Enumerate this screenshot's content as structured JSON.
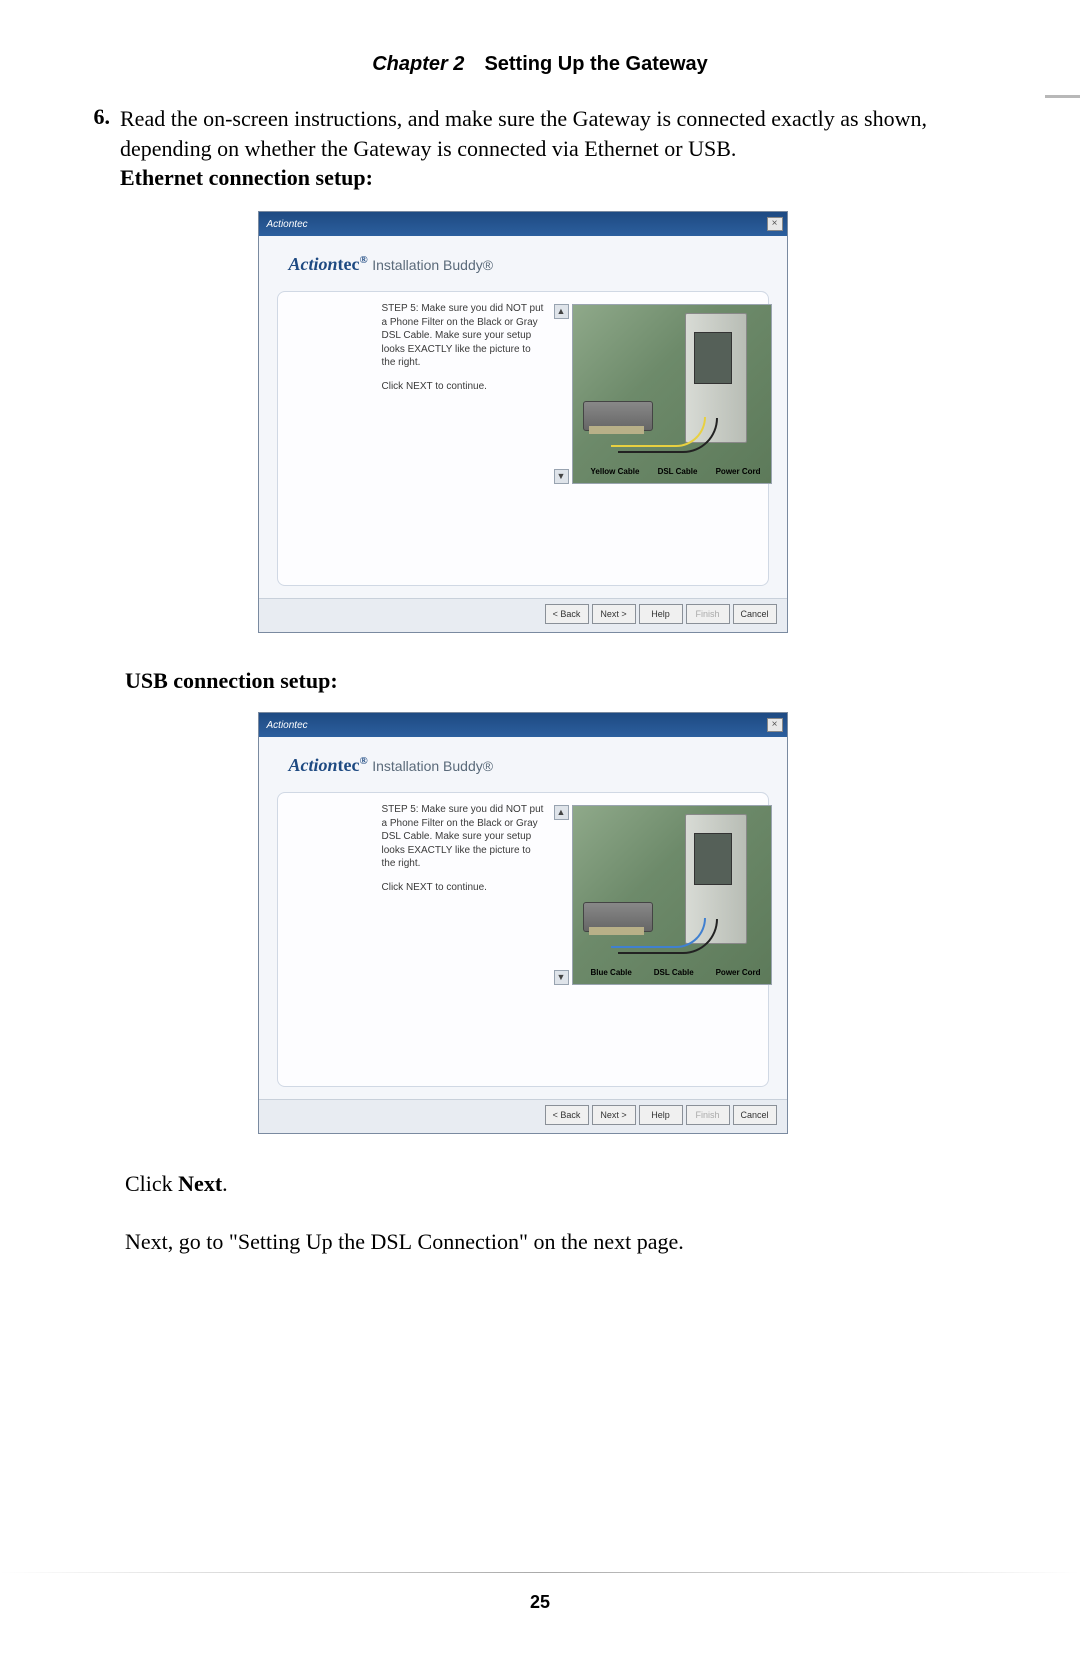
{
  "header": {
    "chapter_label": "Chapter 2",
    "chapter_title": "Setting Up the Gateway"
  },
  "step": {
    "number": "6.",
    "text_a": "Read the on-screen instructions, and make sure the Gateway is connected exactly as shown, depending on whether the Gateway is connected via Ethernet or ",
    "text_b": "USB",
    "text_c": "."
  },
  "ethernet_heading": "Ethernet connection setup:",
  "usb_heading": "USB connection setup:",
  "wizard": {
    "titlebar": "Actiontec",
    "close": "×",
    "brand_action": "Action",
    "brand_tec": "tec",
    "reg": "®",
    "product": " Installation Buddy®",
    "step_text": "STEP 5: Make sure you did NOT put a Phone Filter on the Black or Gray DSL Cable. Make sure your setup looks EXACTLY like the picture to the right.",
    "click_next": "Click NEXT to continue.",
    "scroll_up": "▲",
    "scroll_down": "▼",
    "buttons": {
      "back": "< Back",
      "next": "Next >",
      "help": "Help",
      "finish": "Finish",
      "cancel": "Cancel"
    },
    "ethernet_labels": {
      "l1": "Yellow Cable",
      "l2": "DSL Cable",
      "l3": "Power Cord"
    },
    "usb_labels": {
      "l1": "Blue Cable",
      "l2": "DSL Cable",
      "l3": "Power Cord"
    }
  },
  "click_next_para_a": "Click ",
  "click_next_para_b": "Next",
  "click_next_para_c": ".",
  "next_go": "Next, go to \"Setting Up the DSL Connection\" on the next page.",
  "page_number": "25"
}
